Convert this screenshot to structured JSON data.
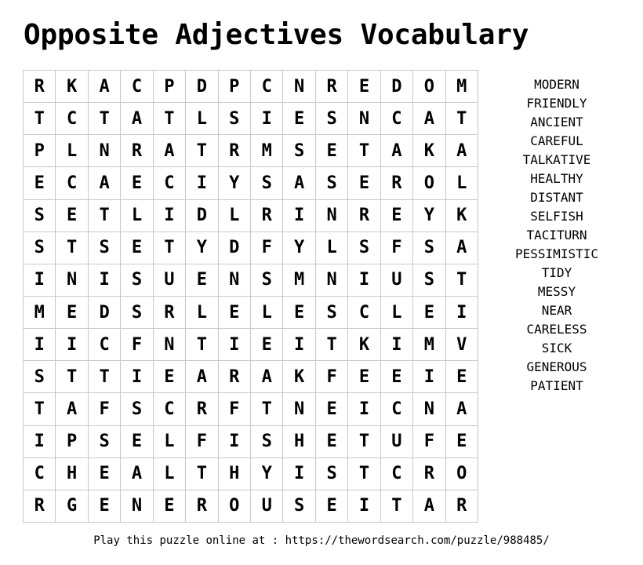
{
  "title": "Opposite Adjectives Vocabulary",
  "grid": [
    [
      "R",
      "K",
      "A",
      "C",
      "P",
      "D",
      "P",
      "C",
      "N",
      "R",
      "E",
      "D",
      "O",
      "M"
    ],
    [
      "T",
      "C",
      "T",
      "A",
      "T",
      "L",
      "S",
      "I",
      "E",
      "S",
      "N",
      "C",
      "A",
      "T"
    ],
    [
      "P",
      "L",
      "N",
      "R",
      "A",
      "T",
      "R",
      "M",
      "S",
      "E",
      "T",
      "A",
      "K",
      "A"
    ],
    [
      "E",
      "C",
      "A",
      "E",
      "C",
      "I",
      "Y",
      "S",
      "A",
      "S",
      "E",
      "R",
      "O",
      "L"
    ],
    [
      "S",
      "E",
      "T",
      "L",
      "I",
      "D",
      "L",
      "R",
      "I",
      "N",
      "R",
      "E",
      "Y",
      "K"
    ],
    [
      "S",
      "T",
      "S",
      "E",
      "T",
      "Y",
      "D",
      "F",
      "Y",
      "L",
      "S",
      "F",
      "S",
      "A"
    ],
    [
      "I",
      "N",
      "I",
      "S",
      "U",
      "E",
      "N",
      "S",
      "M",
      "N",
      "I",
      "U",
      "S",
      "T"
    ],
    [
      "M",
      "E",
      "D",
      "S",
      "R",
      "L",
      "E",
      "L",
      "E",
      "S",
      "C",
      "L",
      "E",
      "I"
    ],
    [
      "I",
      "I",
      "C",
      "F",
      "N",
      "T",
      "I",
      "E",
      "I",
      "T",
      "K",
      "I",
      "M",
      "V"
    ],
    [
      "S",
      "T",
      "T",
      "I",
      "E",
      "A",
      "R",
      "A",
      "K",
      "F",
      "E",
      "E",
      "I",
      "E"
    ],
    [
      "T",
      "A",
      "F",
      "S",
      "C",
      "R",
      "F",
      "T",
      "N",
      "E",
      "I",
      "C",
      "N",
      "A"
    ],
    [
      "I",
      "P",
      "S",
      "E",
      "L",
      "F",
      "I",
      "S",
      "H",
      "E",
      "T",
      "U",
      "F",
      "E"
    ],
    [
      "C",
      "H",
      "E",
      "A",
      "L",
      "T",
      "H",
      "Y",
      "I",
      "S",
      "T",
      "C",
      "R",
      "O"
    ],
    [
      "R",
      "G",
      "E",
      "N",
      "E",
      "R",
      "O",
      "U",
      "S",
      "E",
      "I",
      "T",
      "A",
      "R"
    ]
  ],
  "words": [
    "MODERN",
    "FRIENDLY",
    "ANCIENT",
    "CAREFUL",
    "TALKATIVE",
    "HEALTHY",
    "DISTANT",
    "SELFISH",
    "TACITURN",
    "PESSIMISTIC",
    "TIDY",
    "MESSY",
    "NEAR",
    "CARELESS",
    "SICK",
    "GENEROUS",
    "PATIENT"
  ],
  "footer": "Play this puzzle online at : https://thewordsearch.com/puzzle/988485/"
}
